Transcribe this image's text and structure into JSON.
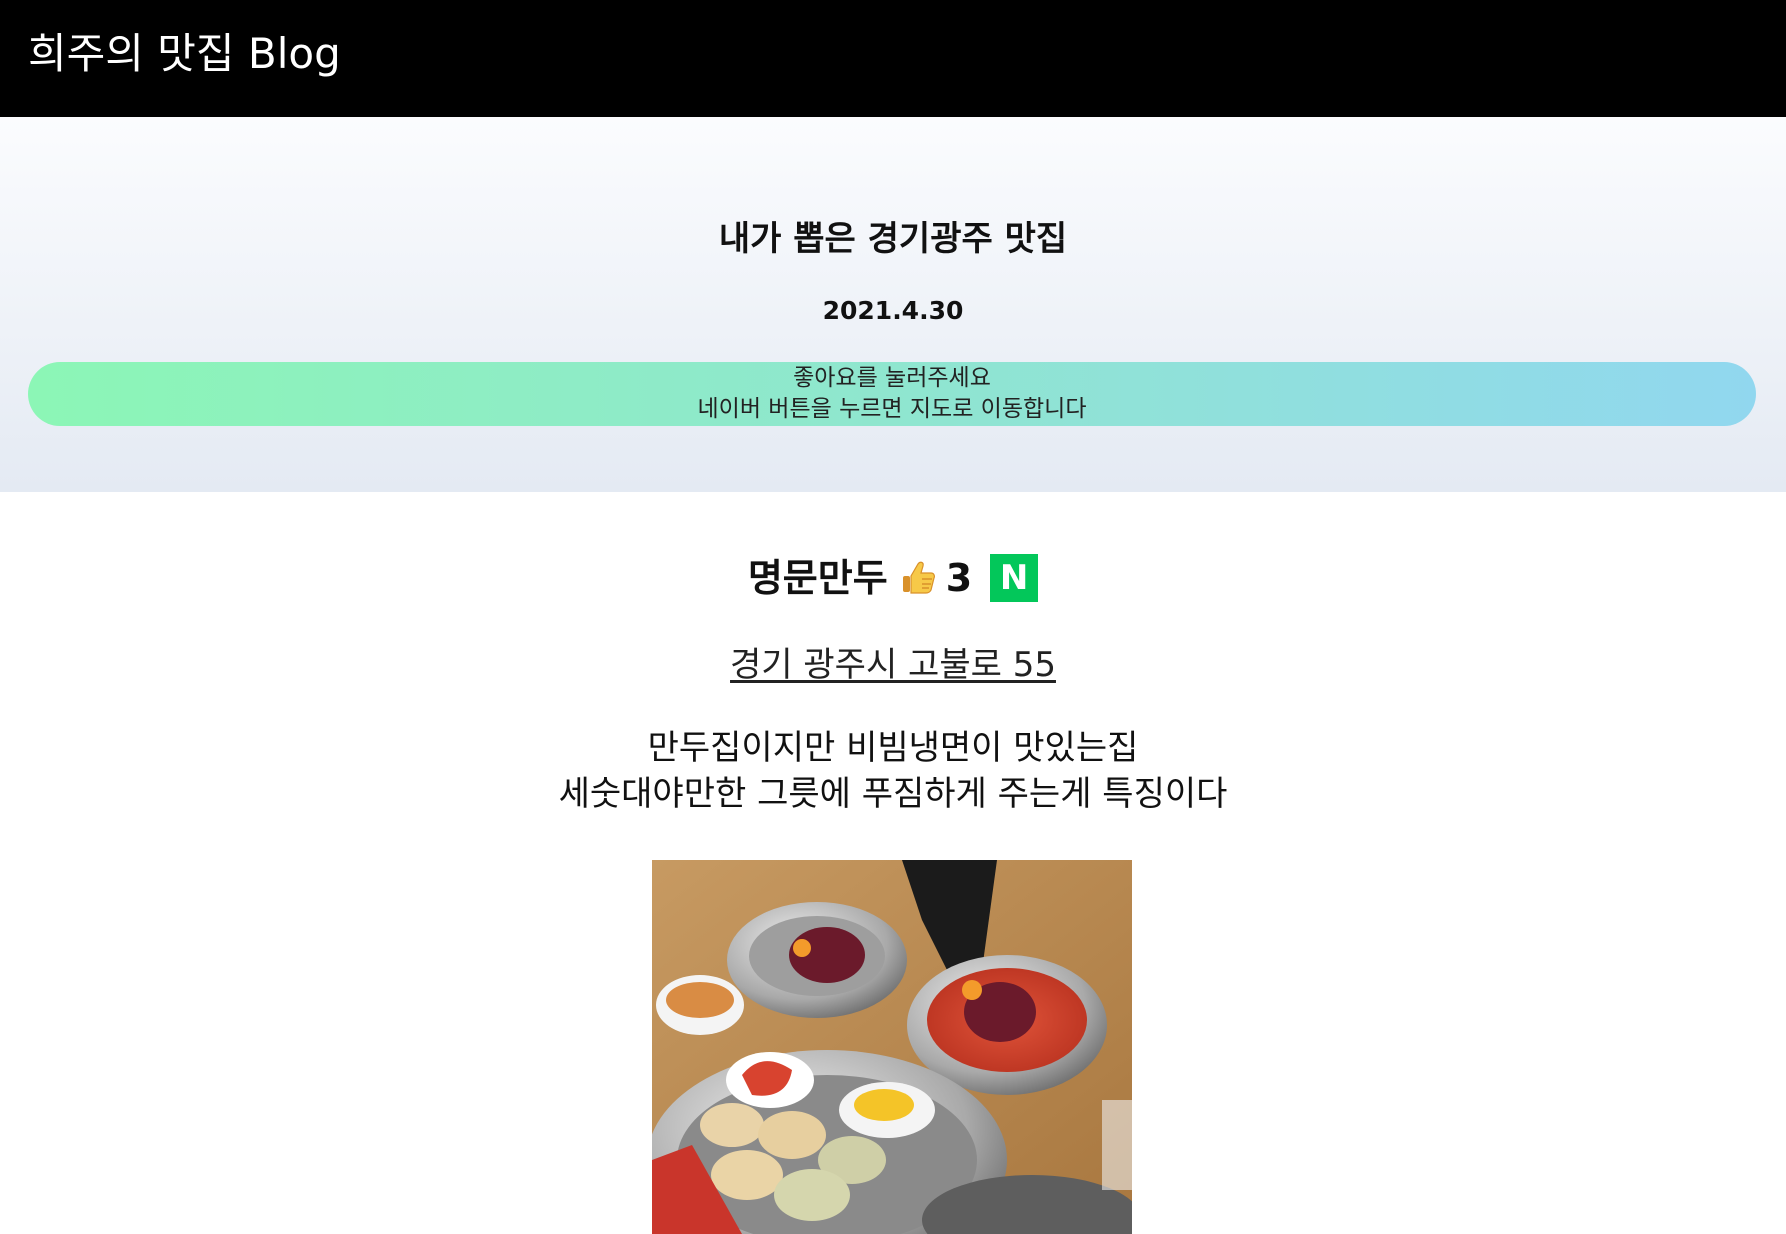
{
  "header": {
    "site_title": "희주의 맛집 Blog"
  },
  "hero": {
    "title": "내가 뽑은 경기광주 맛집",
    "date": "2021.4.30",
    "notice_lines": [
      "좋아요를 눌러주세요",
      "네이버 버튼을 누르면 지도로 이동합니다"
    ]
  },
  "restaurant": {
    "name": "명문만두",
    "like_icon": "thumbs-up-icon",
    "like_count": "3",
    "map_button": {
      "icon": "naver-icon",
      "letter": "N"
    },
    "address": "경기 광주시 고불로 55",
    "description_lines": [
      "만두집이지만 비빔냉면이 맛있는집",
      "세숫대야만한 그릇에 푸짐하게 주는게 특징이다"
    ]
  },
  "colors": {
    "topbar": "#000000",
    "banner_start": "#8cf6b6",
    "banner_end": "#91d7ef",
    "naver_green": "#03c75a"
  }
}
